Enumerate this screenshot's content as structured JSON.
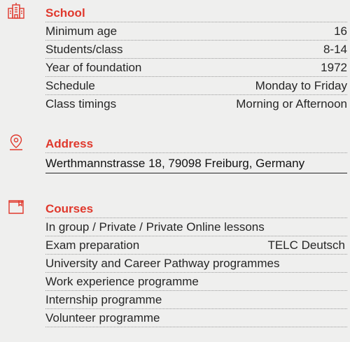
{
  "school": {
    "heading": "School",
    "icon": "school-building-icon",
    "rows": [
      {
        "label": "Minimum age",
        "value": "16"
      },
      {
        "label": "Students/class",
        "value": "8-14"
      },
      {
        "label": "Year of foundation",
        "value": "1972"
      },
      {
        "label": "Schedule",
        "value": "Monday to Friday"
      },
      {
        "label": "Class timings",
        "value": "Morning or Afternoon"
      }
    ]
  },
  "address": {
    "heading": "Address",
    "icon": "location-pin-icon",
    "text": "Werthmannstrasse 18, 79098 Freiburg, Germany"
  },
  "courses": {
    "heading": "Courses",
    "icon": "book-icon",
    "rows": [
      {
        "label": "In group / Private / Private Online lessons",
        "value": ""
      },
      {
        "label": "Exam preparation",
        "value": "TELC Deutsch"
      },
      {
        "label": "University and Career Pathway programmes",
        "value": ""
      },
      {
        "label": "Work experience programme",
        "value": ""
      },
      {
        "label": "Internship programme",
        "value": ""
      },
      {
        "label": "Volunteer programme",
        "value": ""
      }
    ]
  },
  "colors": {
    "accent": "#e0382c",
    "background": "#efefee",
    "text": "#262626"
  }
}
